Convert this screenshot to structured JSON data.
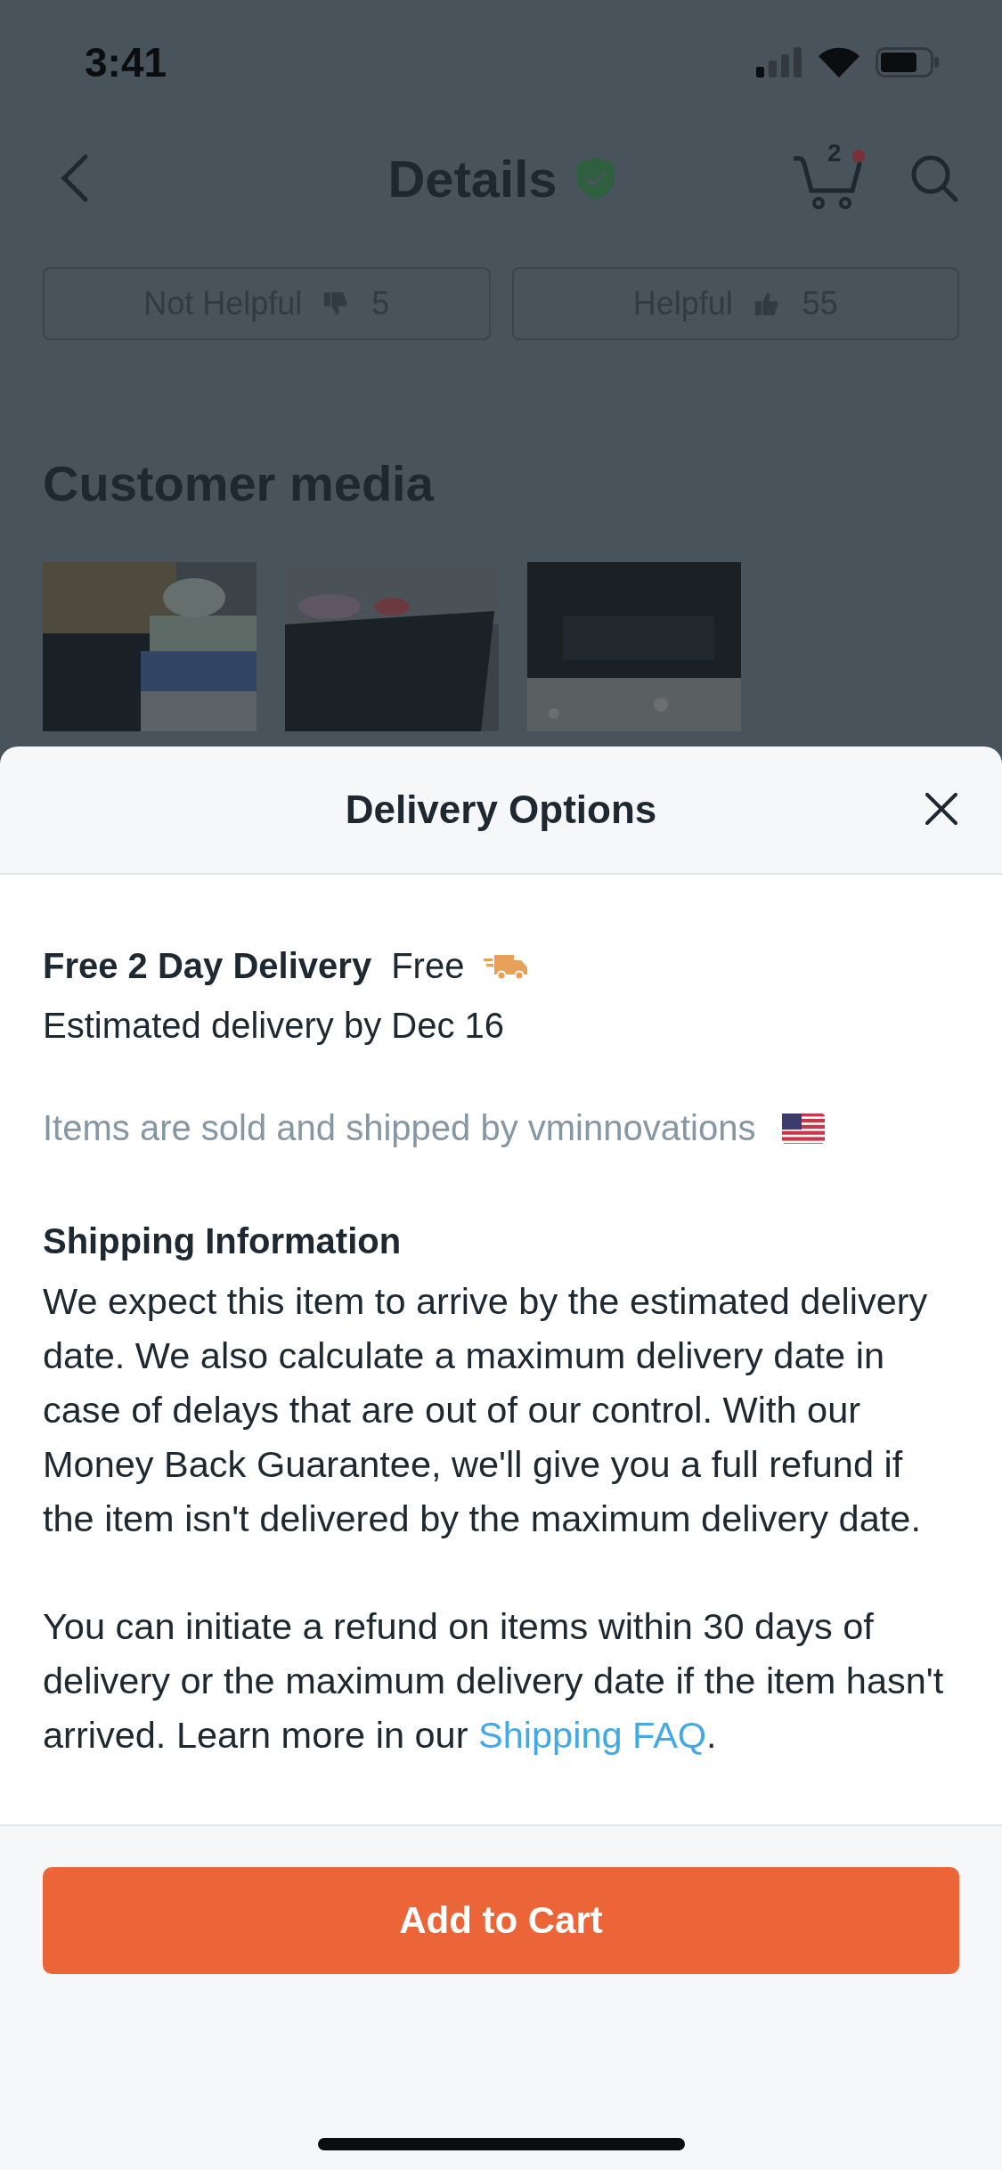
{
  "status_bar": {
    "time": "3:41"
  },
  "nav": {
    "title": "Details",
    "cart_count": "2",
    "cart_alert": true
  },
  "review_actions": [
    {
      "label": "Not Helpful",
      "kind": "down",
      "count": "5"
    },
    {
      "label": "Helpful",
      "kind": "up",
      "count": "55"
    }
  ],
  "customer_media": {
    "title": "Customer media"
  },
  "sheet": {
    "title": "Delivery Options",
    "option": {
      "name": "Free 2 Day Delivery",
      "price": "Free",
      "estimate": "Estimated delivery by Dec 16"
    },
    "seller_note": "Items are sold and shipped by vminnovations",
    "shipping_heading": "Shipping Information",
    "paragraphs": [
      {
        "text": "We expect this item to arrive by the estimated delivery date. We also calculate a maximum delivery date in case of delays that are out of our control. With our Money Back Guarantee, we'll give you a full refund if the item isn't delivered by the maximum delivery date."
      },
      {
        "text": "You can initiate a refund on items within 30 days of delivery or the maximum delivery date if the item hasn't arrived. Learn more in our ",
        "link": "Shipping FAQ",
        "end": "."
      }
    ],
    "button": "Add to Cart"
  }
}
